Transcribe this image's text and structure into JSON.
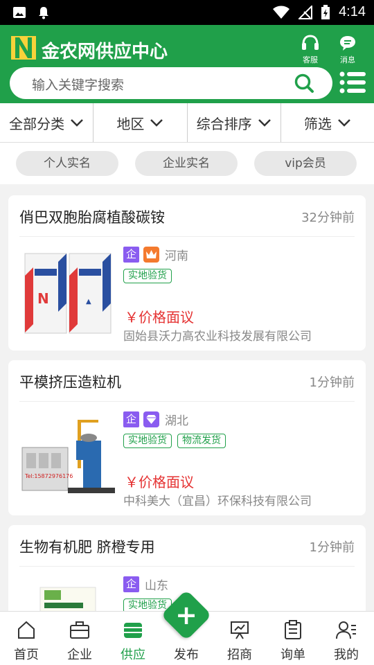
{
  "status_bar": {
    "time": "4:14"
  },
  "header": {
    "title": "金农网供应中心",
    "service_label": "客服",
    "message_label": "消息",
    "search_placeholder": "输入关键字搜索"
  },
  "filters": [
    {
      "label": "全部分类"
    },
    {
      "label": "地区"
    },
    {
      "label": "综合排序"
    },
    {
      "label": "筛选"
    }
  ],
  "tags": [
    {
      "label": "个人实名"
    },
    {
      "label": "企业实名"
    },
    {
      "label": "vip会员"
    }
  ],
  "listings": [
    {
      "title": "俏巴双胞胎腐植酸碳铵",
      "time": "32分钟前",
      "badge": "企",
      "level_icon": "crown-icon",
      "region": "河南",
      "chips": [
        "实地验货"
      ],
      "price": "￥价格面议",
      "company": "固始县沃力高农业科技发展有限公司"
    },
    {
      "title": "平模挤压造粒机",
      "time": "1分钟前",
      "badge": "企",
      "level_icon": "diamond-icon",
      "region": "湖北",
      "chips": [
        "实地验货",
        "物流发货"
      ],
      "price": "￥价格面议",
      "company": "中科美大（宜昌）环保科技有限公司"
    },
    {
      "title": "生物有机肥 脐橙专用",
      "time": "1分钟前",
      "badge": "企",
      "region": "山东",
      "chips": [
        "实地验货"
      ]
    }
  ],
  "bottom_nav": [
    {
      "label": "首页",
      "icon": "home-icon"
    },
    {
      "label": "企业",
      "icon": "briefcase-icon"
    },
    {
      "label": "供应",
      "icon": "supply-icon",
      "active": true
    },
    {
      "label": "发布",
      "icon": "plus-icon"
    },
    {
      "label": "招商",
      "icon": "investment-icon"
    },
    {
      "label": "询单",
      "icon": "clipboard-icon"
    },
    {
      "label": "我的",
      "icon": "profile-icon"
    }
  ],
  "colors": {
    "brand_green": "#20a04a",
    "price_red": "#e53232",
    "badge_purple": "#8a5cf0",
    "crown_orange": "#f47a2e"
  }
}
